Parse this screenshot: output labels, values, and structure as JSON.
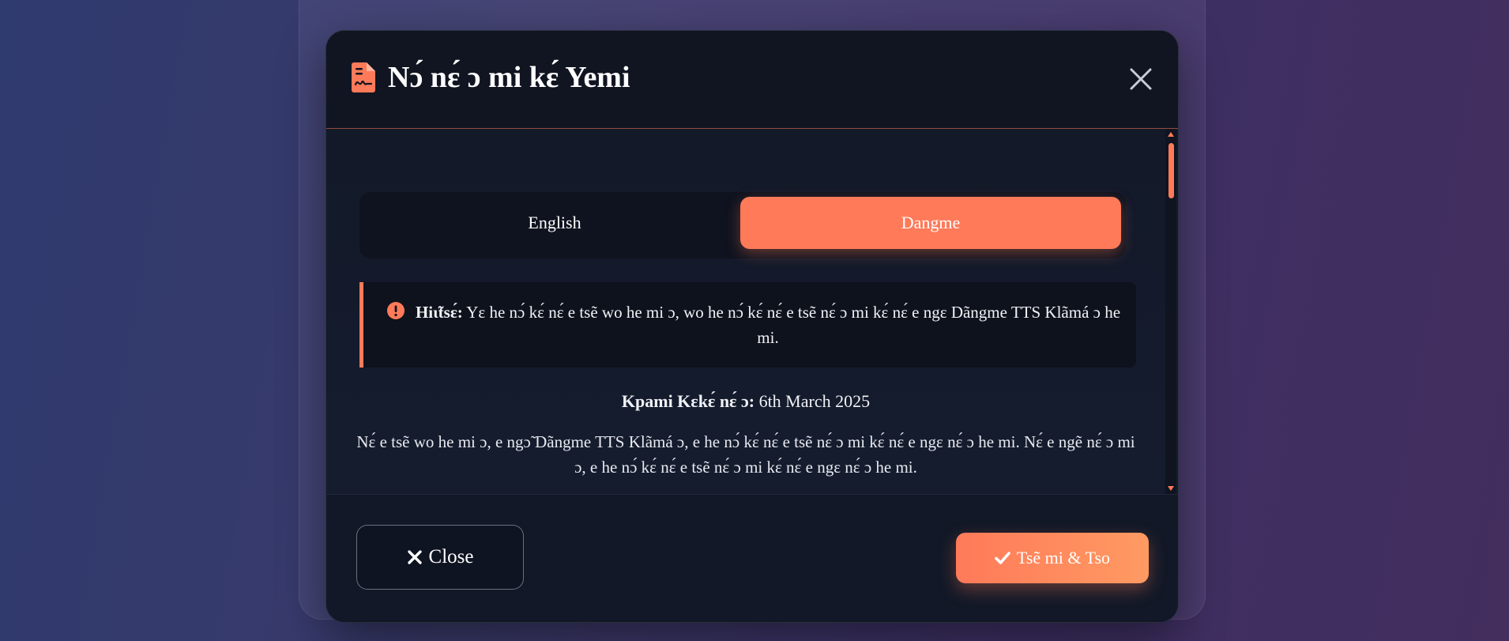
{
  "modal": {
    "title": "Nɔ́ nɛ́ ɔ mi kɛ́ Yemi",
    "icons": {
      "header": "document-signature-icon",
      "close": "close-icon",
      "warning": "exclamation-circle-icon",
      "close_button": "x-icon",
      "accept_button": "check-icon"
    }
  },
  "tabs": [
    {
      "label": "English",
      "active": false
    },
    {
      "label": "Dangme",
      "active": true
    }
  ],
  "warning": {
    "label": "Hiɩ̃tsɛ́:",
    "text": " Yɛ he nɔ́ kɛ́ nɛ́ e tsẽ wo he mi ɔ, wo he nɔ́ kɛ́ nɛ́ e tsẽ nɛ́ ɔ mi kɛ́ nɛ́ e ngɛ Dãngme TTS Klãmá ɔ he mi."
  },
  "date": {
    "label": "Kpami Kɛkɛ́ nɛ́ ɔ:",
    "value": " 6th March 2025"
  },
  "paragraph": "Nɛ́ e tsẽ wo he mi ɔ, e ngɔ̃ Dãngme TTS Klãmá ɔ, e he nɔ́ kɛ́ nɛ́ e tsẽ nɛ́ ɔ mi kɛ́ nɛ́ e ngɛ nɛ́ ɔ he mi. Nɛ́ e ngẽ nɛ́ ɔ mi ɔ, e he nɔ́ kɛ́ nɛ́ e tsẽ nɛ́ ɔ mi kɛ́ nɛ́ e ngɛ nɛ́ ɔ he mi.",
  "footer": {
    "close_label": "Close",
    "accept_label": "Tsẽ mi & Tso"
  },
  "colors": {
    "accent": "#ff7a59",
    "modal_bg": "#121827",
    "header_bg": "#111522"
  }
}
